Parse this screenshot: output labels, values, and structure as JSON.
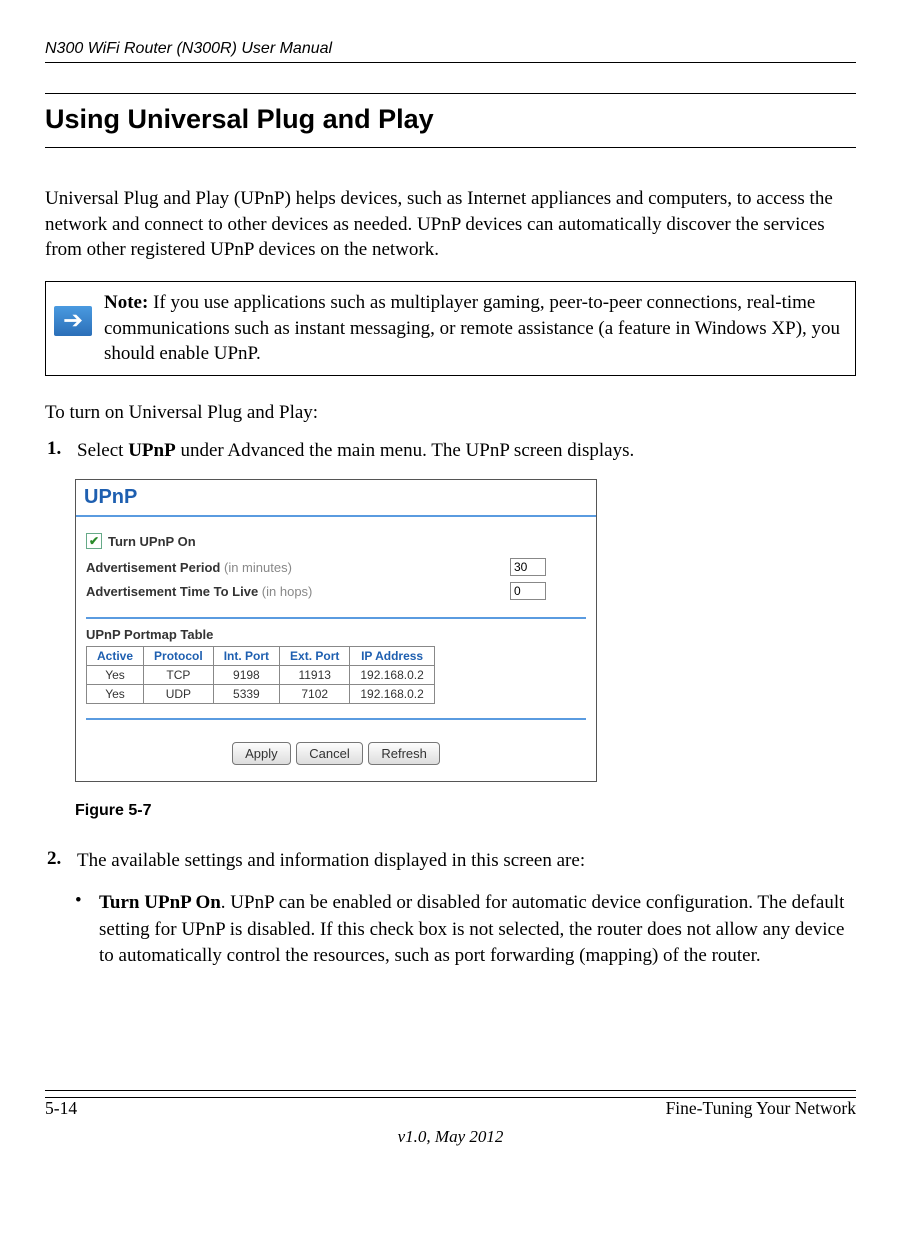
{
  "doc_header": "N300 WiFi Router (N300R) User Manual",
  "section_title": "Using Universal Plug and Play",
  "intro_para": "Universal Plug and Play (UPnP) helps devices, such as Internet appliances and computers, to access the network and connect to other devices as needed. UPnP devices can automatically discover the services from other registered UPnP devices on the network.",
  "note_label": "Note:",
  "note_body": " If you use applications such as multiplayer gaming, peer-to-peer connections, real-time communications such as instant messaging, or remote assistance (a feature in Windows XP), you should enable UPnP.",
  "instr_lead": "To turn on Universal Plug and Play:",
  "step1_num": "1.",
  "step1_pre": "Select ",
  "step1_bold": "UPnP",
  "step1_post": " under Advanced the main menu. The UPnP screen displays.",
  "ss": {
    "title": "UPnP",
    "check_label": "Turn UPnP On",
    "adv_period_label_bold": "Advertisement Period",
    "adv_period_label_gray": " (in minutes)",
    "adv_period_value": "30",
    "adv_ttl_label_bold": "Advertisement Time To Live",
    "adv_ttl_label_gray": " (in hops)",
    "adv_ttl_value": "0",
    "portmap_heading": "UPnP Portmap Table",
    "headers": {
      "active": "Active",
      "protocol": "Protocol",
      "intport": "Int. Port",
      "extport": "Ext. Port",
      "ip": "IP Address"
    },
    "rows": [
      {
        "active": "Yes",
        "protocol": "TCP",
        "intport": "9198",
        "extport": "11913",
        "ip": "192.168.0.2"
      },
      {
        "active": "Yes",
        "protocol": "UDP",
        "intport": "5339",
        "extport": "7102",
        "ip": "192.168.0.2"
      }
    ],
    "buttons": {
      "apply": "Apply",
      "cancel": "Cancel",
      "refresh": "Refresh"
    }
  },
  "figure_caption": "Figure 5-7",
  "step2_num": "2.",
  "step2_text": "The available settings and information displayed in this screen are:",
  "bullet1_bold": "Turn UPnP On",
  "bullet1_rest": ". UPnP can be enabled or disabled for automatic device configuration. The default setting for UPnP is disabled. If this check box is not selected, the router does not allow any device to automatically control the resources, such as port forwarding (mapping) of the router.",
  "footer_page": "5-14",
  "footer_section": "Fine-Tuning Your Network",
  "footer_version": "v1.0, May 2012"
}
